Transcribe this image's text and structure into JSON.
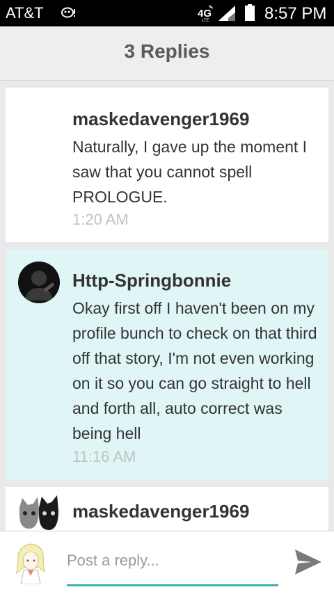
{
  "status_bar": {
    "carrier": "AT&T",
    "network": "4G",
    "time": "8:57 PM",
    "icons": [
      "notification-ghost-icon",
      "4g-lte-icon",
      "signal-icon",
      "battery-icon"
    ]
  },
  "header": {
    "title": "3 Replies"
  },
  "replies": [
    {
      "username": "maskedavenger1969",
      "text": "Naturally, I gave up the moment I saw that you cannot spell PROLOGUE.",
      "time": "1:20 AM"
    },
    {
      "username": "Http-Springbonnie",
      "text": "Okay first off I haven't been on my profile bunch to check on that third off that story, I'm not even working on it so you can go straight to hell and forth all, auto correct was being hell",
      "time": "11:16 AM"
    },
    {
      "username": "maskedavenger1969"
    }
  ],
  "reply_bar": {
    "placeholder": "Post a reply...",
    "send_icon": "send-icon"
  },
  "colors": {
    "highlight_bg": "#e0f5f5",
    "accent": "#3bb0b3",
    "timestamp": "#c2c2c2"
  }
}
